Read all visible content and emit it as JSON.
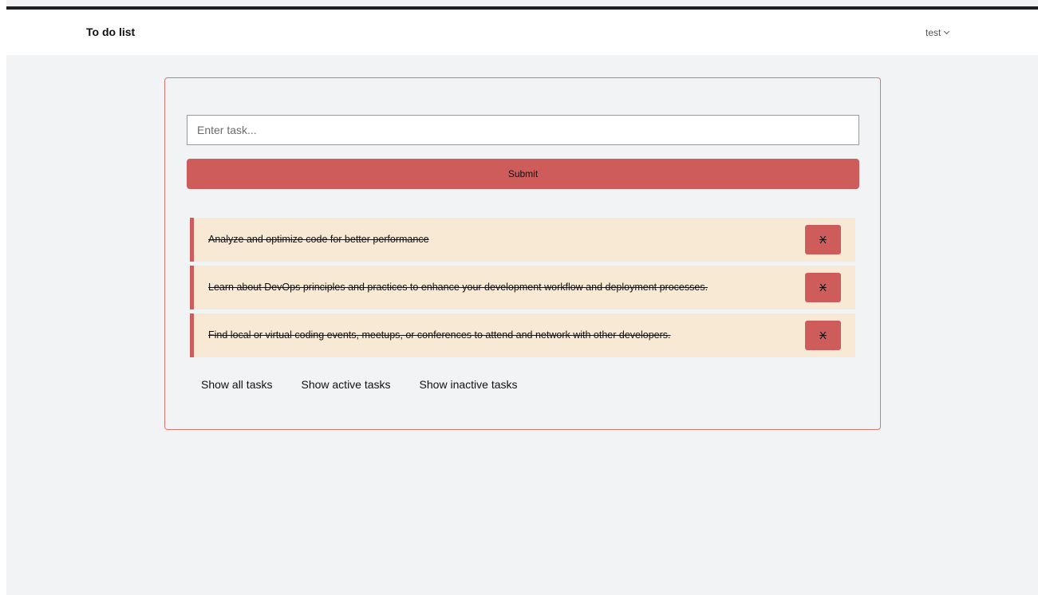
{
  "navbar": {
    "brand": "To do list",
    "user": "test"
  },
  "form": {
    "input_placeholder": "Enter task...",
    "submit_label": "Submit"
  },
  "tasks": [
    {
      "text": "Analyze and optimize code for better performance",
      "delete_label": "X",
      "completed": true
    },
    {
      "text": "Learn about DevOps principles and practices to enhance your development workflow and deployment processes.",
      "delete_label": "X",
      "completed": true
    },
    {
      "text": "Find local or virtual coding events, meetups, or conferences to attend and network with other developers.",
      "delete_label": "X",
      "completed": true
    }
  ],
  "filters": {
    "all": "Show all tasks",
    "active": "Show active tasks",
    "inactive": "Show inactive tasks"
  },
  "colors": {
    "accent": "#cd5c5a",
    "task_bg": "#f8e9d5",
    "page_bg": "#f2f3f5"
  },
  "icons": {
    "user_menu": "chevron-down-icon"
  }
}
